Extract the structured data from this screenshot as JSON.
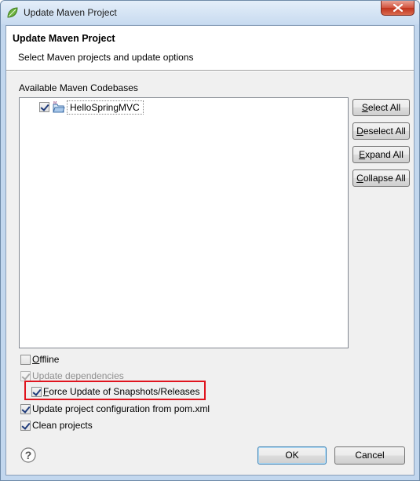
{
  "window": {
    "title": "Update Maven Project"
  },
  "header": {
    "title": "Update Maven Project",
    "description": "Select Maven projects and update options"
  },
  "codebases": {
    "label": "Available Maven Codebases",
    "items": [
      {
        "label": "HelloSpringMVC",
        "checked": true,
        "icon": "maven-project-folder-icon"
      }
    ]
  },
  "side_buttons": {
    "select_all": {
      "mnemonic": "S",
      "rest": "elect All"
    },
    "deselect_all": {
      "mnemonic": "D",
      "rest": "eselect All"
    },
    "expand_all": {
      "mnemonic": "E",
      "rest": "xpand All"
    },
    "collapse_all": {
      "mnemonic": "C",
      "rest": "ollapse All"
    }
  },
  "options": {
    "offline": {
      "mnemonic": "O",
      "rest": "ffline",
      "checked": false
    },
    "update_dependencies": {
      "label": "Update dependencies",
      "checked": true,
      "disabled": true
    },
    "force_update": {
      "mnemonic": "F",
      "rest": "orce Update of Snapshots/Releases",
      "checked": true
    },
    "update_config": {
      "label": "Update project configuration from pom.xml",
      "checked": true
    },
    "clean_projects": {
      "label": "Clean projects",
      "checked": true
    }
  },
  "footer": {
    "ok_label": "OK",
    "cancel_label": "Cancel",
    "help_glyph": "?"
  },
  "colors": {
    "highlight": "#e0141e",
    "client_bg": "#f0f0f0",
    "frame": "#c2d7ee"
  }
}
